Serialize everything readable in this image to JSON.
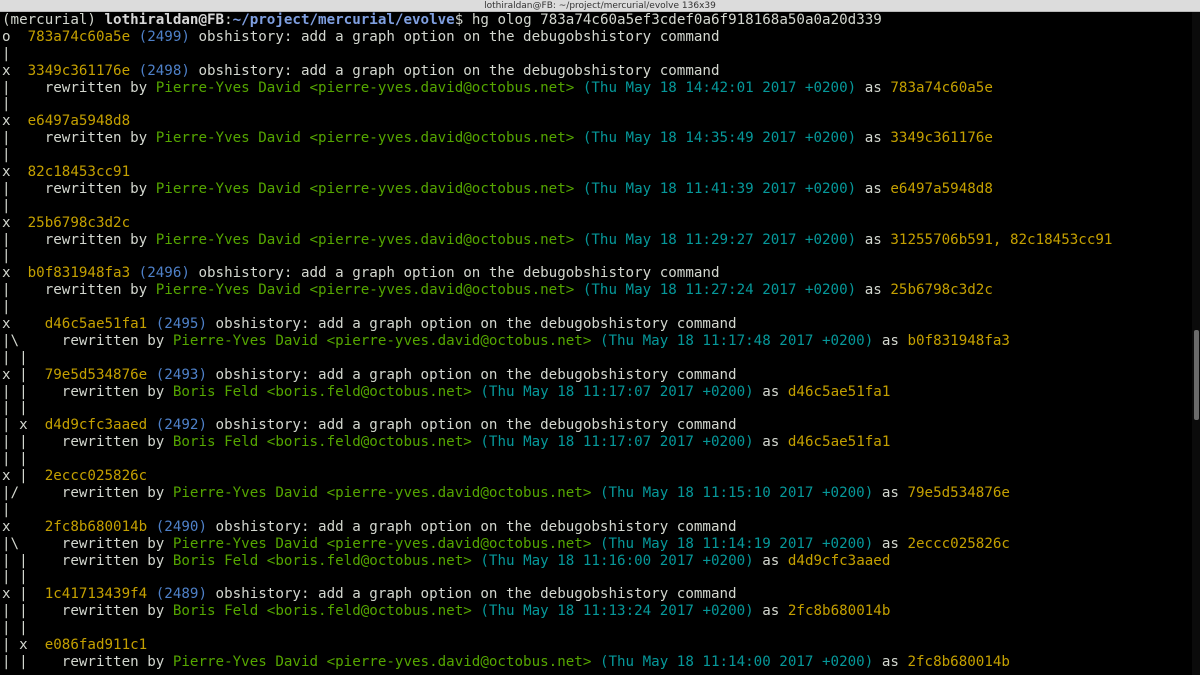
{
  "window": {
    "title": "lothiraldan@FB: ~/project/mercurial/evolve 136x39"
  },
  "colors": {
    "default": "#d3d7cf",
    "prompt_user": "#d7d7d7",
    "prompt_path": "#7f9fe0",
    "hash": "#c4a000",
    "rev": "#4e80c8",
    "user": "#55a600",
    "date": "#06989a"
  },
  "terminal": {
    "lines": [
      [
        [
          "default",
          "(mercurial) "
        ],
        [
          "prompt_user",
          "lothiraldan@FB"
        ],
        [
          "default",
          ":"
        ],
        [
          "prompt_path",
          "~/project/mercurial/evolve"
        ],
        [
          "default",
          "$ hg olog 783a74c60a5ef3cdef0a6f918168a50a0a20d339"
        ]
      ],
      [
        [
          "default",
          "o  "
        ],
        [
          "hash",
          "783a74c60a5e"
        ],
        [
          "default",
          " "
        ],
        [
          "rev",
          "(2499)"
        ],
        [
          "default",
          " obshistory: add a graph option on the debugobshistory command"
        ]
      ],
      [
        [
          "default",
          "|"
        ]
      ],
      [
        [
          "default",
          "x  "
        ],
        [
          "hash",
          "3349c361176e"
        ],
        [
          "default",
          " "
        ],
        [
          "rev",
          "(2498)"
        ],
        [
          "default",
          " obshistory: add a graph option on the debugobshistory command"
        ]
      ],
      [
        [
          "default",
          "|    rewritten by "
        ],
        [
          "user",
          "Pierre-Yves David <pierre-yves.david@octobus.net>"
        ],
        [
          "default",
          " "
        ],
        [
          "date",
          "(Thu May 18 14:42:01 2017 +0200)"
        ],
        [
          "default",
          " as "
        ],
        [
          "hash",
          "783a74c60a5e"
        ]
      ],
      [
        [
          "default",
          "|"
        ]
      ],
      [
        [
          "default",
          "x  "
        ],
        [
          "hash",
          "e6497a5948d8"
        ]
      ],
      [
        [
          "default",
          "|    rewritten by "
        ],
        [
          "user",
          "Pierre-Yves David <pierre-yves.david@octobus.net>"
        ],
        [
          "default",
          " "
        ],
        [
          "date",
          "(Thu May 18 14:35:49 2017 +0200)"
        ],
        [
          "default",
          " as "
        ],
        [
          "hash",
          "3349c361176e"
        ]
      ],
      [
        [
          "default",
          "|"
        ]
      ],
      [
        [
          "default",
          "x  "
        ],
        [
          "hash",
          "82c18453cc91"
        ]
      ],
      [
        [
          "default",
          "|    rewritten by "
        ],
        [
          "user",
          "Pierre-Yves David <pierre-yves.david@octobus.net>"
        ],
        [
          "default",
          " "
        ],
        [
          "date",
          "(Thu May 18 11:41:39 2017 +0200)"
        ],
        [
          "default",
          " as "
        ],
        [
          "hash",
          "e6497a5948d8"
        ]
      ],
      [
        [
          "default",
          "|"
        ]
      ],
      [
        [
          "default",
          "x  "
        ],
        [
          "hash",
          "25b6798c3d2c"
        ]
      ],
      [
        [
          "default",
          "|    rewritten by "
        ],
        [
          "user",
          "Pierre-Yves David <pierre-yves.david@octobus.net>"
        ],
        [
          "default",
          " "
        ],
        [
          "date",
          "(Thu May 18 11:29:27 2017 +0200)"
        ],
        [
          "default",
          " as "
        ],
        [
          "hash",
          "31255706b591, 82c18453cc91"
        ]
      ],
      [
        [
          "default",
          "|"
        ]
      ],
      [
        [
          "default",
          "x  "
        ],
        [
          "hash",
          "b0f831948fa3"
        ],
        [
          "default",
          " "
        ],
        [
          "rev",
          "(2496)"
        ],
        [
          "default",
          " obshistory: add a graph option on the debugobshistory command"
        ]
      ],
      [
        [
          "default",
          "|    rewritten by "
        ],
        [
          "user",
          "Pierre-Yves David <pierre-yves.david@octobus.net>"
        ],
        [
          "default",
          " "
        ],
        [
          "date",
          "(Thu May 18 11:27:24 2017 +0200)"
        ],
        [
          "default",
          " as "
        ],
        [
          "hash",
          "25b6798c3d2c"
        ]
      ],
      [
        [
          "default",
          "|"
        ]
      ],
      [
        [
          "default",
          "x    "
        ],
        [
          "hash",
          "d46c5ae51fa1"
        ],
        [
          "default",
          " "
        ],
        [
          "rev",
          "(2495)"
        ],
        [
          "default",
          " obshistory: add a graph option on the debugobshistory command"
        ]
      ],
      [
        [
          "default",
          "|\\     rewritten by "
        ],
        [
          "user",
          "Pierre-Yves David <pierre-yves.david@octobus.net>"
        ],
        [
          "default",
          " "
        ],
        [
          "date",
          "(Thu May 18 11:17:48 2017 +0200)"
        ],
        [
          "default",
          " as "
        ],
        [
          "hash",
          "b0f831948fa3"
        ]
      ],
      [
        [
          "default",
          "| |"
        ]
      ],
      [
        [
          "default",
          "x |  "
        ],
        [
          "hash",
          "79e5d534876e"
        ],
        [
          "default",
          " "
        ],
        [
          "rev",
          "(2493)"
        ],
        [
          "default",
          " obshistory: add a graph option on the debugobshistory command"
        ]
      ],
      [
        [
          "default",
          "| |    rewritten by "
        ],
        [
          "user",
          "Boris Feld <boris.feld@octobus.net>"
        ],
        [
          "default",
          " "
        ],
        [
          "date",
          "(Thu May 18 11:17:07 2017 +0200)"
        ],
        [
          "default",
          " as "
        ],
        [
          "hash",
          "d46c5ae51fa1"
        ]
      ],
      [
        [
          "default",
          "| |"
        ]
      ],
      [
        [
          "default",
          "| x  "
        ],
        [
          "hash",
          "d4d9cfc3aaed"
        ],
        [
          "default",
          " "
        ],
        [
          "rev",
          "(2492)"
        ],
        [
          "default",
          " obshistory: add a graph option on the debugobshistory command"
        ]
      ],
      [
        [
          "default",
          "| |    rewritten by "
        ],
        [
          "user",
          "Boris Feld <boris.feld@octobus.net>"
        ],
        [
          "default",
          " "
        ],
        [
          "date",
          "(Thu May 18 11:17:07 2017 +0200)"
        ],
        [
          "default",
          " as "
        ],
        [
          "hash",
          "d46c5ae51fa1"
        ]
      ],
      [
        [
          "default",
          "| |"
        ]
      ],
      [
        [
          "default",
          "x |  "
        ],
        [
          "hash",
          "2eccc025826c"
        ]
      ],
      [
        [
          "default",
          "|/     rewritten by "
        ],
        [
          "user",
          "Pierre-Yves David <pierre-yves.david@octobus.net>"
        ],
        [
          "default",
          " "
        ],
        [
          "date",
          "(Thu May 18 11:15:10 2017 +0200)"
        ],
        [
          "default",
          " as "
        ],
        [
          "hash",
          "79e5d534876e"
        ]
      ],
      [
        [
          "default",
          "|"
        ]
      ],
      [
        [
          "default",
          "x    "
        ],
        [
          "hash",
          "2fc8b680014b"
        ],
        [
          "default",
          " "
        ],
        [
          "rev",
          "(2490)"
        ],
        [
          "default",
          " obshistory: add a graph option on the debugobshistory command"
        ]
      ],
      [
        [
          "default",
          "|\\     rewritten by "
        ],
        [
          "user",
          "Pierre-Yves David <pierre-yves.david@octobus.net>"
        ],
        [
          "default",
          " "
        ],
        [
          "date",
          "(Thu May 18 11:14:19 2017 +0200)"
        ],
        [
          "default",
          " as "
        ],
        [
          "hash",
          "2eccc025826c"
        ]
      ],
      [
        [
          "default",
          "| |    rewritten by "
        ],
        [
          "user",
          "Boris Feld <boris.feld@octobus.net>"
        ],
        [
          "default",
          " "
        ],
        [
          "date",
          "(Thu May 18 11:16:00 2017 +0200)"
        ],
        [
          "default",
          " as "
        ],
        [
          "hash",
          "d4d9cfc3aaed"
        ]
      ],
      [
        [
          "default",
          "| |"
        ]
      ],
      [
        [
          "default",
          "x |  "
        ],
        [
          "hash",
          "1c41713439f4"
        ],
        [
          "default",
          " "
        ],
        [
          "rev",
          "(2489)"
        ],
        [
          "default",
          " obshistory: add a graph option on the debugobshistory command"
        ]
      ],
      [
        [
          "default",
          "| |    rewritten by "
        ],
        [
          "user",
          "Boris Feld <boris.feld@octobus.net>"
        ],
        [
          "default",
          " "
        ],
        [
          "date",
          "(Thu May 18 11:13:24 2017 +0200)"
        ],
        [
          "default",
          " as "
        ],
        [
          "hash",
          "2fc8b680014b"
        ]
      ],
      [
        [
          "default",
          "| |"
        ]
      ],
      [
        [
          "default",
          "| x  "
        ],
        [
          "hash",
          "e086fad911c1"
        ]
      ],
      [
        [
          "default",
          "| |    rewritten by "
        ],
        [
          "user",
          "Pierre-Yves David <pierre-yves.david@octobus.net>"
        ],
        [
          "default",
          " "
        ],
        [
          "date",
          "(Thu May 18 11:14:00 2017 +0200)"
        ],
        [
          "default",
          " as "
        ],
        [
          "hash",
          "2fc8b680014b"
        ]
      ]
    ]
  }
}
